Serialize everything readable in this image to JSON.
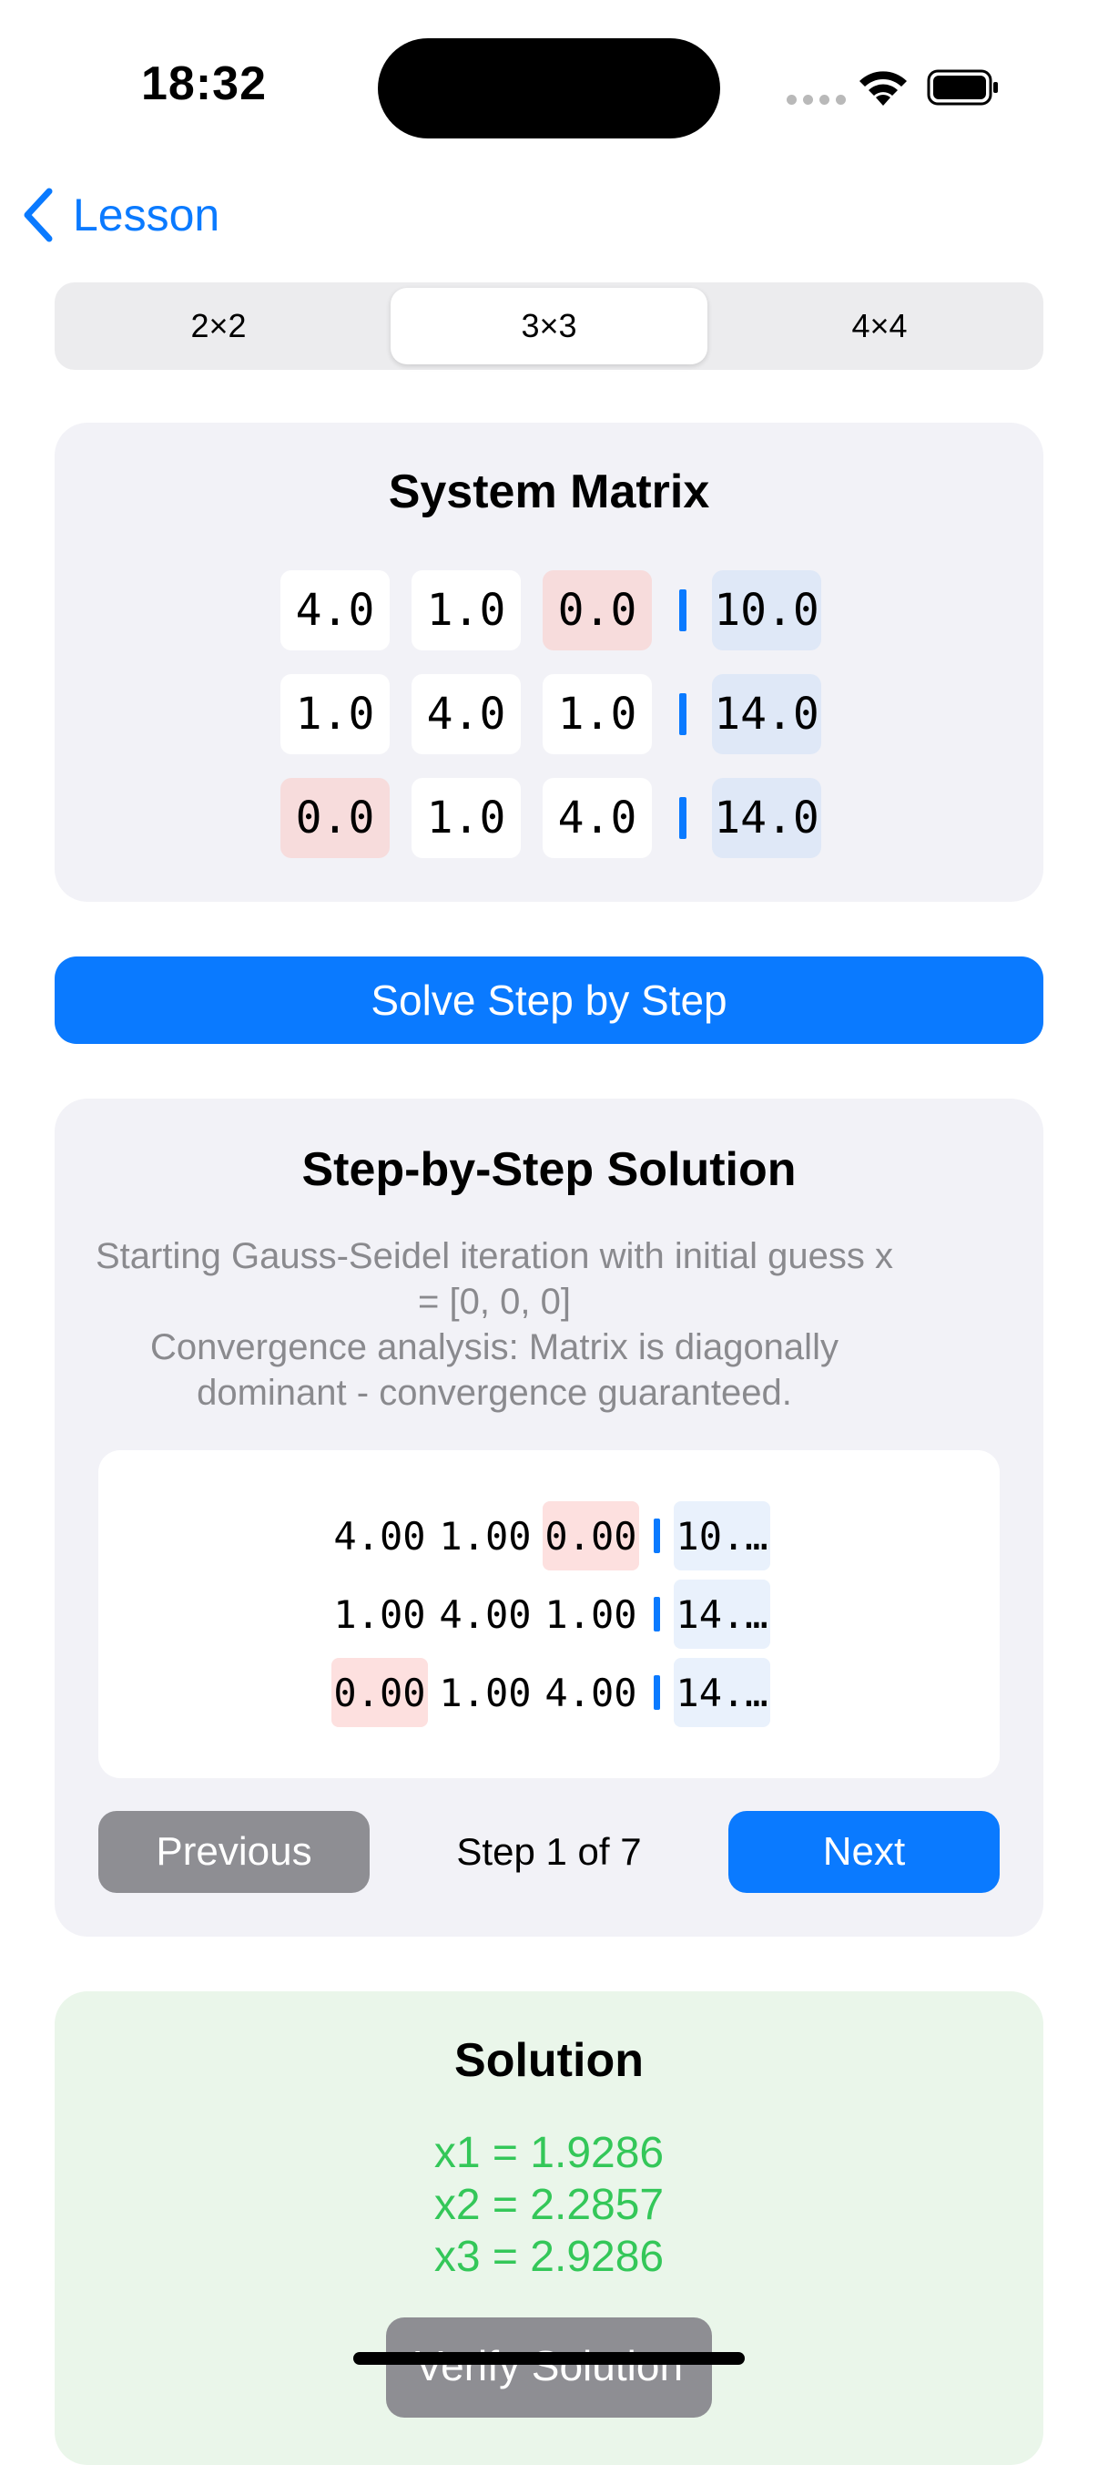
{
  "status_bar": {
    "time": "18:32"
  },
  "nav": {
    "back_label": "Lesson"
  },
  "segments": [
    {
      "label": "2×2",
      "selected": false
    },
    {
      "label": "3×3",
      "selected": true
    },
    {
      "label": "4×4",
      "selected": false
    }
  ],
  "system_matrix": {
    "title": "System Matrix",
    "rows": [
      [
        "4.0",
        "1.0",
        "0.0",
        "10.0"
      ],
      [
        "1.0",
        "4.0",
        "1.0",
        "14.0"
      ],
      [
        "0.0",
        "1.0",
        "4.0",
        "14.0"
      ]
    ]
  },
  "solve_button": "Solve Step by Step",
  "steps": {
    "title": "Step-by-Step Solution",
    "explanation": [
      "Starting Gauss-Seidel iteration with initial guess x",
      "= [0, 0, 0]",
      "Convergence analysis: Matrix is diagonally",
      "dominant - convergence guaranteed."
    ],
    "matrix": [
      [
        "4.00",
        "1.00",
        "0.00",
        "10.…"
      ],
      [
        "1.00",
        "4.00",
        "1.00",
        "14.…"
      ],
      [
        "0.00",
        "1.00",
        "4.00",
        "14.…"
      ]
    ],
    "previous_label": "Previous",
    "step_indicator": "Step 1 of 7",
    "next_label": "Next"
  },
  "solution": {
    "title": "Solution",
    "lines": [
      "x1 = 1.9286",
      "x2 = 2.2857",
      "x3 = 2.9286"
    ],
    "verify_label": "Verify Solution"
  },
  "colors": {
    "accent": "#0A7AFF",
    "success": "#34C759",
    "zero_highlight": "#F7DCDC",
    "rhs_highlight": "#DFE8F7",
    "disabled": "#8E8E93"
  }
}
